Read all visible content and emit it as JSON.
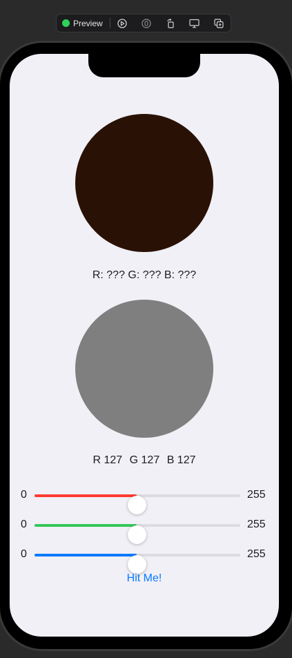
{
  "toolbar": {
    "preview_label": "Preview",
    "live_color": "#30d158",
    "icons": [
      "live-preview-icon",
      "selectable-icon",
      "rotate-icon",
      "device-settings-icon",
      "duplicate-icon"
    ]
  },
  "target": {
    "color": "#2a1105",
    "label": "R: ??? G: ??? B: ???"
  },
  "guess": {
    "color": "#7f7f7f",
    "r_label": "R 127",
    "g_label": "G 127",
    "b_label": "B 127"
  },
  "sliders": [
    {
      "name": "red",
      "min": "0",
      "max": "255",
      "value": 127,
      "color": "#ff3b30"
    },
    {
      "name": "green",
      "min": "0",
      "max": "255",
      "value": 127,
      "color": "#34c759"
    },
    {
      "name": "blue",
      "min": "0",
      "max": "255",
      "value": 127,
      "color": "#0a7aff"
    }
  ],
  "hit_button": {
    "label": "Hit Me!",
    "color": "#0a7aff"
  }
}
